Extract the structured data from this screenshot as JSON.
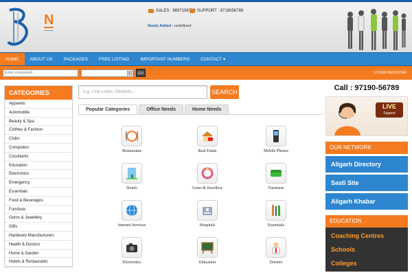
{
  "header": {
    "sales": "SALES : 9897156789",
    "support": "SUPPORT : 9719056789",
    "newly_added_label": "Newly Added :",
    "newly_added_value": "undefined"
  },
  "nav": {
    "items": [
      {
        "label": "HOME"
      },
      {
        "label": "ABOUT US"
      },
      {
        "label": "PACKAGES"
      },
      {
        "label": "FREE LISTING"
      },
      {
        "label": "IMPORTANT NUMBERS"
      },
      {
        "label": "CONTACT ▾"
      }
    ]
  },
  "searchbar": {
    "keyword_placeholder": "Enter a keyword..",
    "go_label": "GO",
    "login_label": "LOGIN REGISTER"
  },
  "categories": {
    "title": "CATEGORIES",
    "items": [
      "Apparels",
      "Automobile",
      "Beauty & Spa",
      "Clothes & Fashion",
      "Clubs",
      "Computers",
      "Cosultants",
      "Education",
      "Electronics",
      "Emergency",
      "Essentials",
      "Food & Beverages",
      "Furniture",
      "Gems & Jewellery",
      "Gifts",
      "Hardware Manufacturers",
      "Health & Doctors",
      "Home & Garden",
      "Hotels & Restaurants"
    ]
  },
  "search": {
    "placeholder": "e.g. Link Locks, Dentists...",
    "button_label": "SEARCH"
  },
  "tabs": [
    {
      "label": "Popular Categories"
    },
    {
      "label": "Office Needs"
    },
    {
      "label": "Home Needs"
    }
  ],
  "grid": [
    {
      "label": "Restaurants",
      "icon": "restaurant-icon"
    },
    {
      "label": "Real Estate",
      "icon": "real-estate-icon"
    },
    {
      "label": "Mobile Phones",
      "icon": "mobile-phone-icon"
    },
    {
      "label": "Hotels",
      "icon": "hotel-icon"
    },
    {
      "label": "Gems & Jewellery",
      "icon": "jewellery-icon"
    },
    {
      "label": "Furniture",
      "icon": "sofa-icon"
    },
    {
      "label": "Internet Services",
      "icon": "globe-icon"
    },
    {
      "label": "Hospitals",
      "icon": "hospital-icon"
    },
    {
      "label": "Essentials",
      "icon": "tools-icon"
    },
    {
      "label": "Electronics",
      "icon": "camera-icon"
    },
    {
      "label": "Education",
      "icon": "chalkboard-icon"
    },
    {
      "label": "Doctors",
      "icon": "doctor-icon"
    }
  ],
  "right": {
    "call": "Call : 97190-56789",
    "live_big": "LIVE",
    "live_small": "Support",
    "network_title": "OUR NETWORK",
    "network": [
      "Aligarh Directory",
      "Sasti Site",
      "Aligarh Khabar"
    ],
    "education_title": "EDUCATION",
    "education": [
      "Coaching Centres",
      "Schools",
      "Colleges"
    ]
  },
  "colors": {
    "accent_orange": "#f47b20",
    "nav_blue": "#2d86cf"
  }
}
